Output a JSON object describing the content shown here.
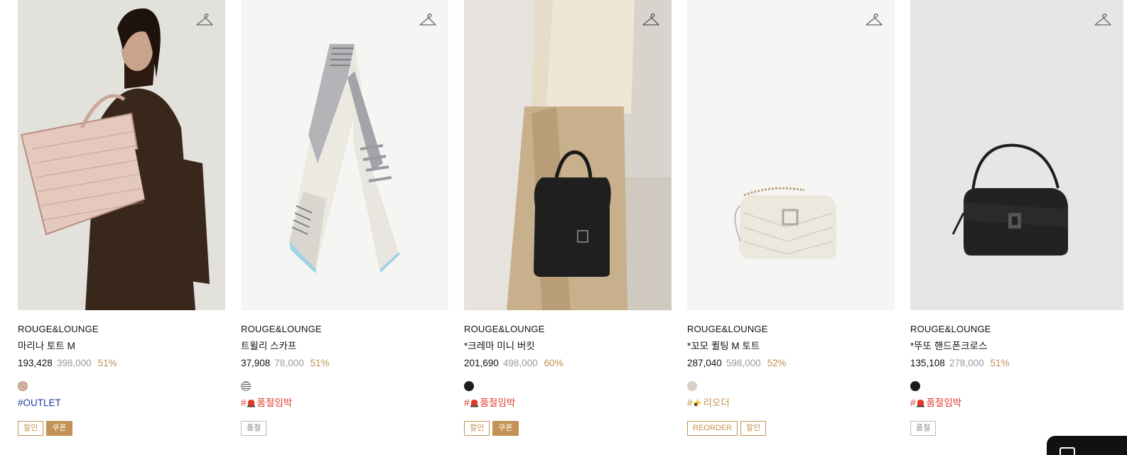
{
  "products": [
    {
      "brand": "ROUGE&LOUNGE",
      "name": "마리나 토트 M",
      "price": "193,428",
      "original_price": "398,000",
      "discount": "51%",
      "swatch": "woven-pink",
      "tag": "#OUTLET",
      "badges": [
        "할인",
        "쿠폰"
      ]
    },
    {
      "brand": "ROUGE&LOUNGE",
      "name": "트윌리 스카프",
      "price": "37,908",
      "original_price": "78,000",
      "discount": "51%",
      "swatch": "striped-gray",
      "tag": "#",
      "tag_text": "품절임박",
      "badges": [
        "품절"
      ]
    },
    {
      "brand": "ROUGE&LOUNGE",
      "name": "*크레마 미니 버킷",
      "price": "201,690",
      "original_price": "498,000",
      "discount": "60%",
      "swatch": "#1c1c1c",
      "tag": "#",
      "tag_text": "품절임박",
      "badges": [
        "할인",
        "쿠폰"
      ]
    },
    {
      "brand": "ROUGE&LOUNGE",
      "name": "*꼬모 퀼팅 M 토트",
      "price": "287,040",
      "original_price": "598,000",
      "discount": "52%",
      "swatch": "#d8d2c4",
      "tag": "#",
      "tag_text": "리오더",
      "badges": [
        "REORDER",
        "할인"
      ]
    },
    {
      "brand": "ROUGE&LOUNGE",
      "name": "*뚜또 핸드폰크로스",
      "price": "135,108",
      "original_price": "278,000",
      "discount": "51%",
      "swatch": "#1c1c1c",
      "tag": "#",
      "tag_text": "품절임박",
      "badges": [
        "품절"
      ]
    }
  ],
  "colors": {
    "accent": "#c39154",
    "tag_red": "#e0392a",
    "tag_blue": "#1a3a9e",
    "muted": "#9a9a9a"
  },
  "icons": {
    "wishlist": "hanger-icon",
    "siren": "siren-emoji",
    "sparkle": "star-emoji"
  }
}
